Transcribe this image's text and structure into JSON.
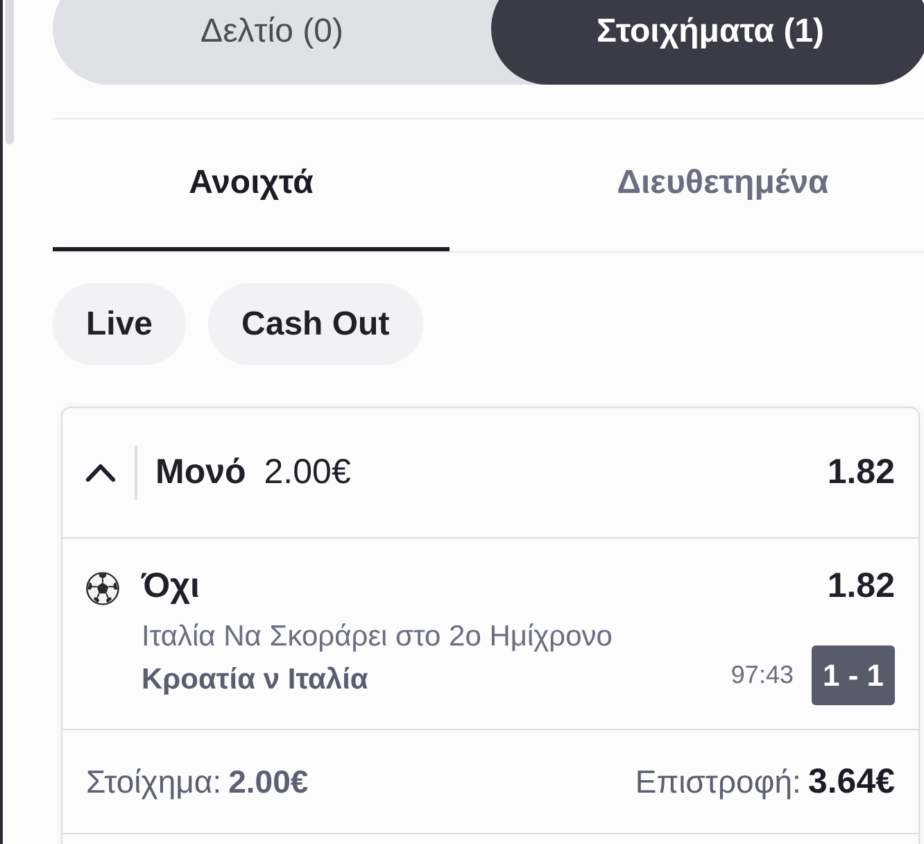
{
  "bet_toggle": [
    {
      "label": "Δελτίο (0)",
      "selected": false
    },
    {
      "label": "Στοιχήματα (1)",
      "selected": true
    }
  ],
  "tabs": [
    {
      "label": "Ανοιχτά",
      "selected": true
    },
    {
      "label": "Διευθετημένα",
      "selected": false
    }
  ],
  "filters": [
    {
      "label": "Live",
      "selected": false
    },
    {
      "label": "Cash Out",
      "selected": false
    }
  ],
  "bet_card": {
    "expanded": true,
    "type": "Μονό",
    "stake": "2.00€",
    "odds": "1.82",
    "selections": [
      {
        "kind": "football",
        "pick": "Όχι",
        "odds": "1.82",
        "market": "Ιταλία Να Σκοράρει στο 2ο Ημίχρονο",
        "event": "Κροατία ν Ιταλία",
        "clock": "97:43",
        "score": "1 - 1"
      }
    ],
    "stake_label": "Στοίχημα:",
    "stake_value": "2.00€",
    "return_label": "Επιστροφή:",
    "return_value": "3.64€"
  }
}
